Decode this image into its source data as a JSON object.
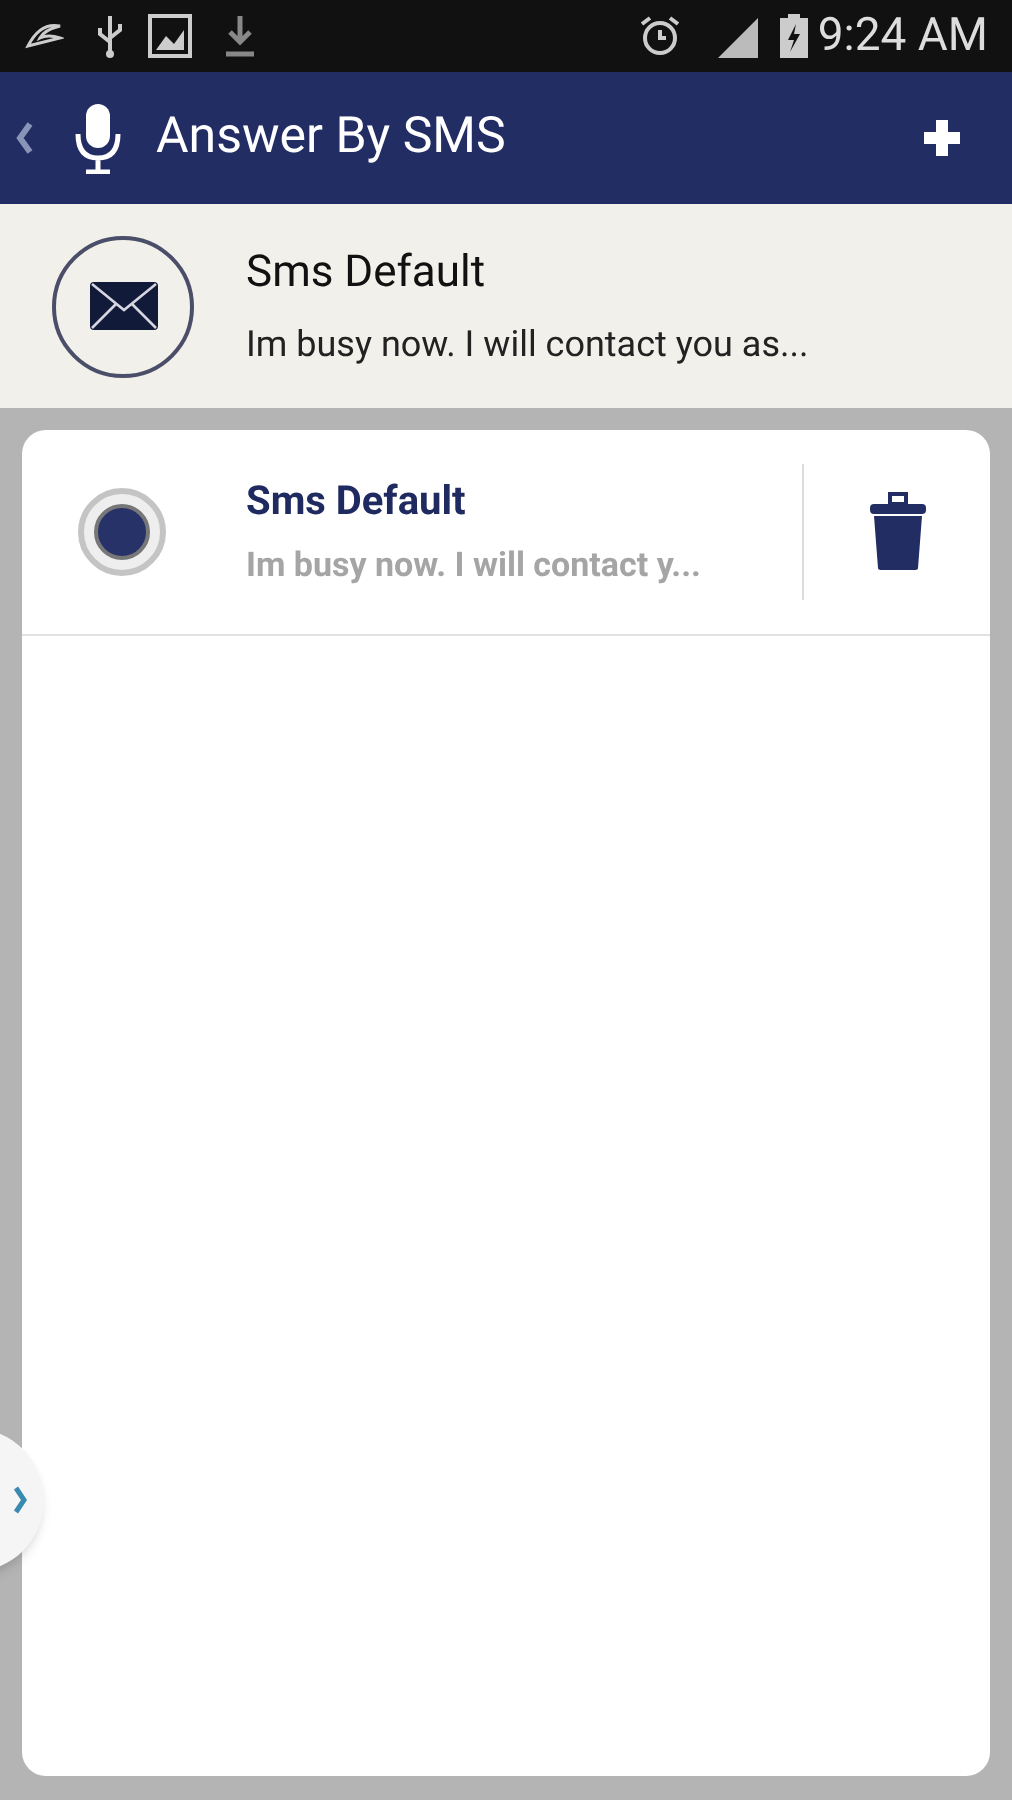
{
  "status_bar": {
    "time": "9:24 AM"
  },
  "app_bar": {
    "title": "Answer By SMS"
  },
  "current": {
    "title": "Sms Default",
    "message": "Im busy now. I will contact you as..."
  },
  "messages": [
    {
      "title": "Sms Default",
      "message": "Im busy now. I will contact y...",
      "selected": true
    }
  ]
}
